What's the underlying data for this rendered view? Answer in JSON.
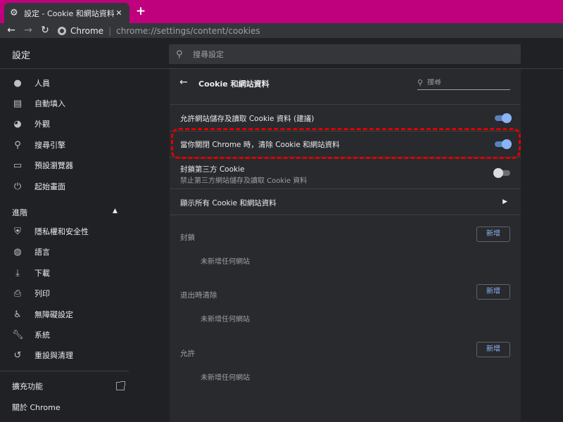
{
  "browser": {
    "tab_title": "設定 - Cookie 和網站資料",
    "new_tab_label": "+",
    "omnibox_origin": "Chrome",
    "omnibox_separator": "|",
    "omnibox_url": "chrome://settings/content/cookies",
    "tab_strip_color": "#c0017e"
  },
  "header": {
    "app_title": "設定",
    "search_placeholder": "搜尋設定"
  },
  "sidebar": {
    "items": [
      {
        "icon": "person-icon",
        "label": "人員"
      },
      {
        "icon": "assignment-icon",
        "label": "自動填入"
      },
      {
        "icon": "palette-icon",
        "label": "外觀"
      },
      {
        "icon": "search-icon",
        "label": "搜尋引擎"
      },
      {
        "icon": "browser-icon",
        "label": "預設瀏覽器"
      },
      {
        "icon": "power-icon",
        "label": "起始畫面"
      }
    ],
    "advanced_label": "進階",
    "advanced_items": [
      {
        "icon": "shield-icon",
        "label": "隱私權和安全性"
      },
      {
        "icon": "globe-icon",
        "label": "語言"
      },
      {
        "icon": "download-icon",
        "label": "下載"
      },
      {
        "icon": "print-icon",
        "label": "列印"
      },
      {
        "icon": "accessibility-icon",
        "label": "無障礙設定"
      },
      {
        "icon": "wrench-icon",
        "label": "系統"
      },
      {
        "icon": "history-icon",
        "label": "重設與清理"
      }
    ],
    "extensions_label": "擴充功能",
    "about_label": "關於 Chrome"
  },
  "page": {
    "title": "Cookie 和網站資料",
    "search_placeholder": "搜尋",
    "settings": [
      {
        "label": "允許網站儲存及讀取 Cookie 資料 (建議)",
        "enabled": true
      },
      {
        "label": "當你關閉 Chrome 時，清除 Cookie 和網站資料",
        "enabled": true,
        "highlighted": true
      },
      {
        "label": "封鎖第三方 Cookie",
        "sublabel": "禁止第三方網站儲存及讀取 Cookie 資料",
        "enabled": false
      }
    ],
    "see_all_label": "顯示所有 Cookie 和網站資料",
    "sections": [
      {
        "label": "封鎖",
        "add_label": "新增",
        "empty_text": "未新增任何網站"
      },
      {
        "label": "退出時清除",
        "add_label": "新增",
        "empty_text": "未新增任何網站"
      },
      {
        "label": "允許",
        "add_label": "新增",
        "empty_text": "未新增任何網站"
      }
    ]
  },
  "colors": {
    "accent": "#8ab4f8",
    "highlight_border": "#e00000"
  }
}
